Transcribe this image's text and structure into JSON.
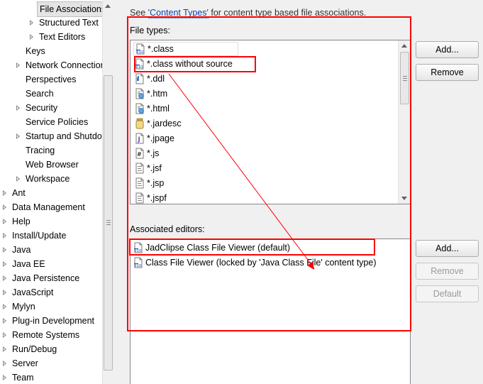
{
  "tree": {
    "items": [
      {
        "label": "File Associations",
        "selected": true,
        "expandable": false
      },
      {
        "label": "Structured Text",
        "expandable": true
      },
      {
        "label": "Text Editors",
        "expandable": true
      },
      {
        "label": "Keys",
        "expandable": false
      },
      {
        "label": "Network Connections",
        "expandable": true
      },
      {
        "label": "Perspectives",
        "expandable": false
      },
      {
        "label": "Search",
        "expandable": false
      },
      {
        "label": "Security",
        "expandable": true
      },
      {
        "label": "Service Policies",
        "expandable": false
      },
      {
        "label": "Startup and Shutdown",
        "expandable": true
      },
      {
        "label": "Tracing",
        "expandable": false
      },
      {
        "label": "Web Browser",
        "expandable": false
      },
      {
        "label": "Workspace",
        "expandable": true
      },
      {
        "label": "Ant",
        "expandable": true
      },
      {
        "label": "Data Management",
        "expandable": true
      },
      {
        "label": "Help",
        "expandable": true
      },
      {
        "label": "Install/Update",
        "expandable": true
      },
      {
        "label": "Java",
        "expandable": true
      },
      {
        "label": "Java EE",
        "expandable": true
      },
      {
        "label": "Java Persistence",
        "expandable": true
      },
      {
        "label": "JavaScript",
        "expandable": true
      },
      {
        "label": "Mylyn",
        "expandable": true
      },
      {
        "label": "Plug-in Development",
        "expandable": true
      },
      {
        "label": "Remote Systems",
        "expandable": true
      },
      {
        "label": "Run/Debug",
        "expandable": true
      },
      {
        "label": "Server",
        "expandable": true
      },
      {
        "label": "Team",
        "expandable": true
      }
    ]
  },
  "hint": {
    "prefix": "See ",
    "link": "'Content Types'",
    "suffix": " for content type based file associations."
  },
  "file_types": {
    "label": "File types:",
    "items": [
      {
        "label": "*.class",
        "icon": "class-file-icon"
      },
      {
        "label": "*.class without source",
        "icon": "class-file-icon"
      },
      {
        "label": "*.ddl",
        "icon": "ddl-file-icon"
      },
      {
        "label": "*.htm",
        "icon": "html-file-icon"
      },
      {
        "label": "*.html",
        "icon": "html-file-icon"
      },
      {
        "label": "*.jardesc",
        "icon": "jar-file-icon"
      },
      {
        "label": "*.jpage",
        "icon": "java-file-icon"
      },
      {
        "label": "*.js",
        "icon": "js-file-icon"
      },
      {
        "label": "*.jsf",
        "icon": "jsp-file-icon"
      },
      {
        "label": "*.jsp",
        "icon": "jsp-file-icon"
      },
      {
        "label": "*.jspf",
        "icon": "jsp-file-icon"
      }
    ],
    "add_label": "Add...",
    "remove_label": "Remove"
  },
  "editors": {
    "label": "Associated editors:",
    "items": [
      {
        "label": "JadClipse Class File Viewer (default)",
        "icon": "class-file-icon"
      },
      {
        "label": "Class File Viewer (locked by 'Java Class File' content type)",
        "icon": "class-file-icon"
      }
    ],
    "add_label": "Add...",
    "remove_label": "Remove",
    "default_label": "Default"
  },
  "annotation_color": "#ff0000"
}
